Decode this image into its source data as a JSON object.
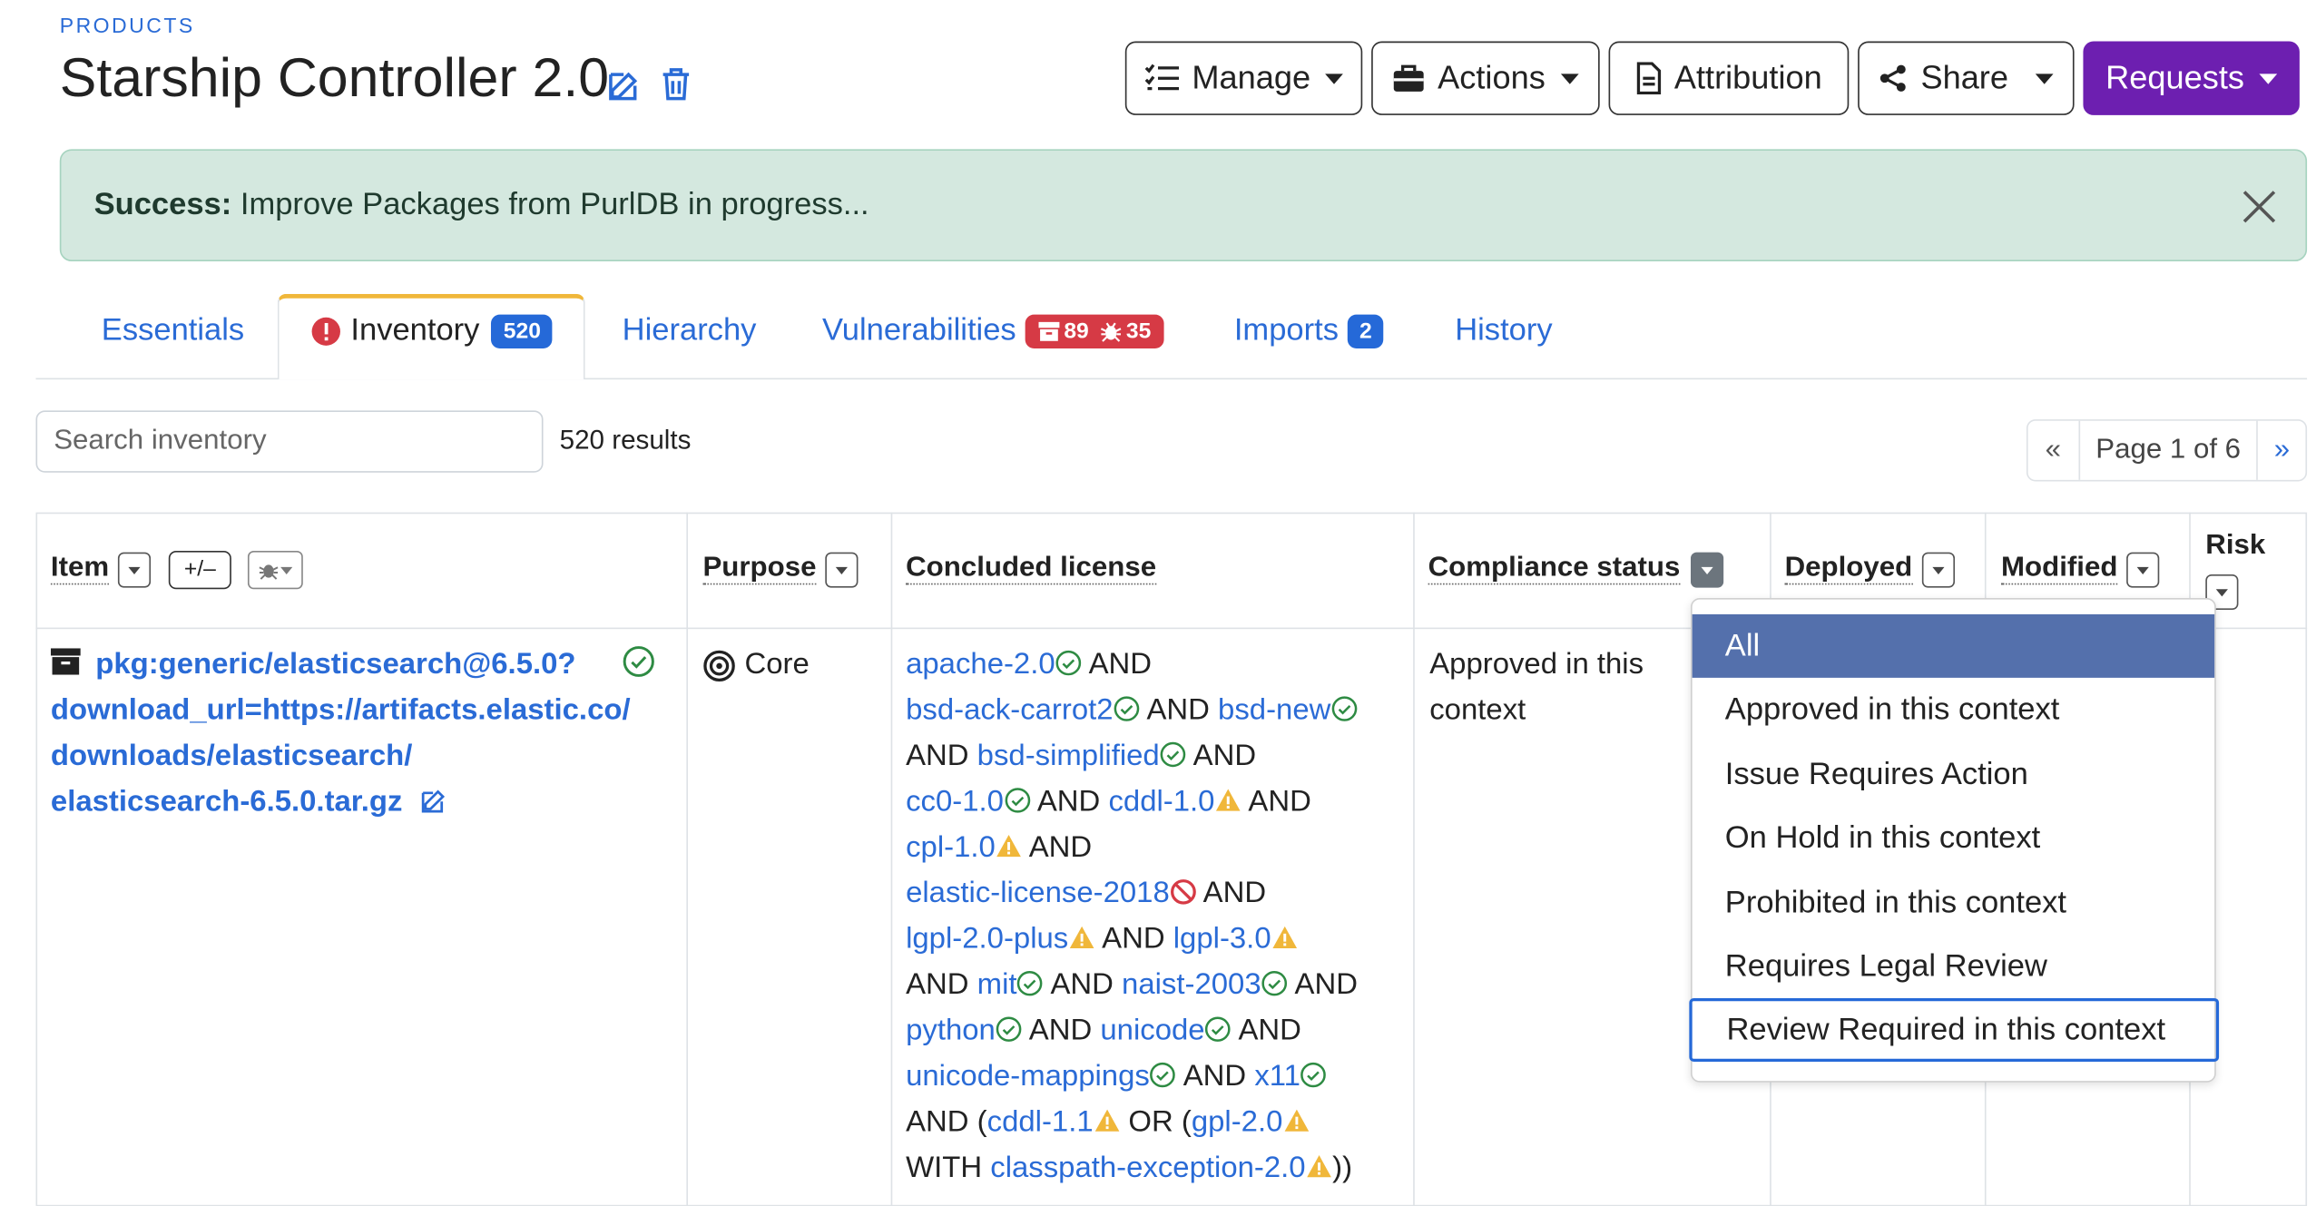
{
  "header": {
    "eyebrow": "PRODUCTS",
    "title": "Starship Controller 2.0",
    "buttons": {
      "manage": "Manage",
      "actions": "Actions",
      "attribution": "Attribution",
      "share": "Share",
      "requests": "Requests"
    }
  },
  "alert": {
    "strong": "Success:",
    "message": " Improve Packages from PurlDB in progress..."
  },
  "tabs": {
    "essentials": "Essentials",
    "inventory": "Inventory",
    "inventory_count": "520",
    "hierarchy": "Hierarchy",
    "vulnerabilities": "Vulnerabilities",
    "vuln_packages": "89",
    "vuln_count": "35",
    "imports": "Imports",
    "imports_count": "2",
    "history": "History"
  },
  "search": {
    "placeholder": "Search inventory",
    "results": "520 results"
  },
  "pager": {
    "prev": "«",
    "label": "Page 1 of 6",
    "next": "»"
  },
  "columns": {
    "item": "Item",
    "item_toggle": "+/–",
    "purpose": "Purpose",
    "license": "Concluded license",
    "compliance": "Compliance status",
    "deployed": "Deployed",
    "modified": "Modified",
    "risk": "Risk"
  },
  "row": {
    "package_lines": [
      "pkg:generic/elasticsearch@6.5.0?",
      "download_url=https://artifacts.elastic.co/",
      "downloads/elasticsearch/",
      "elasticsearch-6.5.0.tar.gz"
    ],
    "purpose": "Core",
    "compliance_lines": [
      "Approved in this",
      "context"
    ],
    "licenses": {
      "apache": "apache-2.0",
      "bsd_ack": "bsd-ack-carrot2",
      "bsd_new": "bsd-new",
      "bsd_simplified": "bsd-simplified",
      "cc0": "cc0-1.0",
      "cddl10": "cddl-1.0",
      "cpl": "cpl-1.0",
      "elastic": "elastic-license-2018",
      "lgpl2": "lgpl-2.0-plus",
      "lgpl3": "lgpl-3.0",
      "mit": "mit",
      "naist": "naist-2003",
      "python": "python",
      "unicode": "unicode",
      "unicode_map": "unicode-mappings",
      "x11": "x11",
      "cddl11": "cddl-1.1",
      "gpl2": "gpl-2.0",
      "classpath": "classpath-exception-2.0"
    },
    "ops": {
      "and": "AND",
      "or": "OR",
      "with": "WITH",
      "lparen": "(",
      "rparen2": "))"
    }
  },
  "dropdown": {
    "options": [
      "All",
      "Approved in this context",
      "Issue Requires Action",
      "On Hold in this context",
      "Prohibited in this context",
      "Requires Legal Review",
      "Review Required in this context"
    ]
  },
  "colors": {
    "link": "#2a6bd6",
    "purple": "#6d1fb0",
    "success_bg": "#d4e8df",
    "danger": "#d63a45",
    "ok": "#2e8b43",
    "warn": "#f0b73a",
    "selected": "#5470ac"
  },
  "icons": [
    "edit-icon",
    "trash-icon",
    "checklist-icon",
    "toolbox-icon",
    "file-icon",
    "share-icon",
    "close-icon",
    "alert-circle-icon",
    "archive-icon",
    "bug-icon",
    "target-icon",
    "check-circle-icon",
    "warning-icon",
    "prohibited-icon"
  ]
}
